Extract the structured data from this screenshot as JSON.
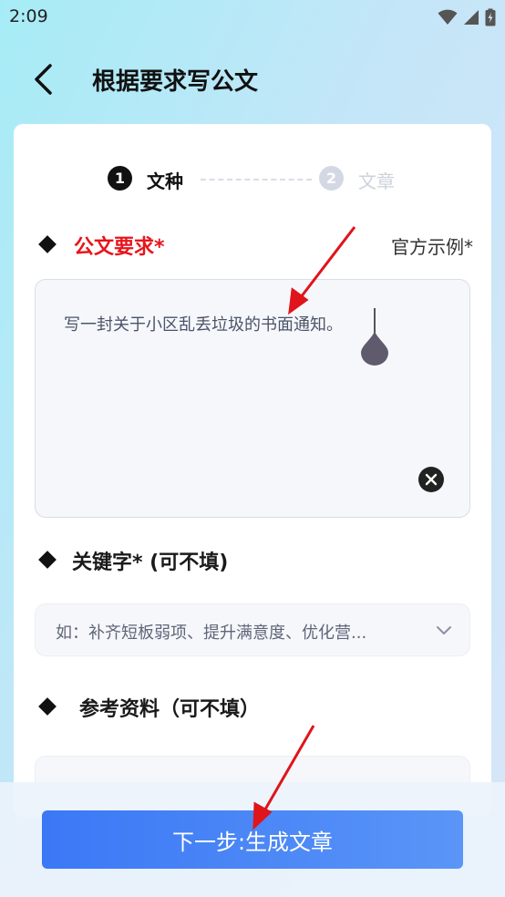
{
  "status_bar": {
    "time": "2:09"
  },
  "header": {
    "title": "根据要求写公文"
  },
  "stepper": {
    "step1": {
      "number": "1",
      "label": "文种"
    },
    "step2": {
      "number": "2",
      "label": "文章"
    }
  },
  "requirements": {
    "title": "公文要求*",
    "example_link": "官方示例*",
    "value": "写一封关于小区乱丢垃圾的书面通知。"
  },
  "keywords": {
    "title": "关键字* (可不填)",
    "placeholder": "如：补齐短板弱项、提升满意度、优化营..."
  },
  "reference": {
    "title": "参考资料（可不填）"
  },
  "footer": {
    "next_label": "下一步:生成文章"
  },
  "colors": {
    "required_title": "#e8151b",
    "primary_button": "#3b78f6",
    "active_step": "#111111",
    "inactive_step": "#d4d8e4",
    "annotation_arrow": "#e0141b"
  }
}
